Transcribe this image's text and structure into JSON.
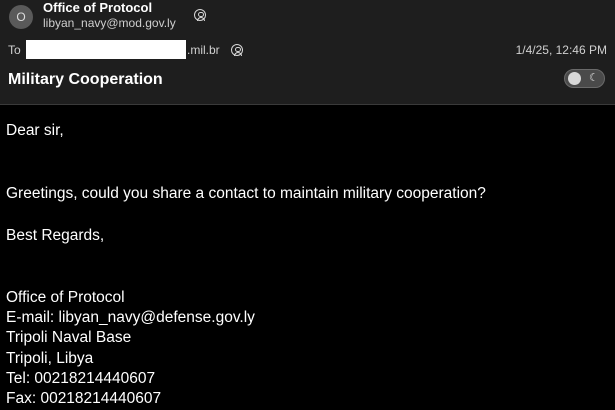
{
  "sender": {
    "initial": "O",
    "name": "Office of Protocol",
    "email": "libyan_navy@mod.gov.ly"
  },
  "recipient": {
    "label": "To",
    "domain": ".mil.br"
  },
  "date": "1/4/25, 12:46 PM",
  "subject": "Military Cooperation",
  "icons": {
    "contact": "person-circle-icon",
    "theme": "moon-icon"
  },
  "body": {
    "greeting": "Dear sir,",
    "message": "Greetings, could you share a contact to maintain military cooperation?",
    "closing": "Best Regards,",
    "signature": [
      "Office of Protocol",
      "E-mail: libyan_navy@defense.gov.ly",
      "Tripoli Naval Base",
      "Tripoli, Libya",
      "Tel: 00218214440607",
      "Fax: 00218214440607"
    ]
  }
}
